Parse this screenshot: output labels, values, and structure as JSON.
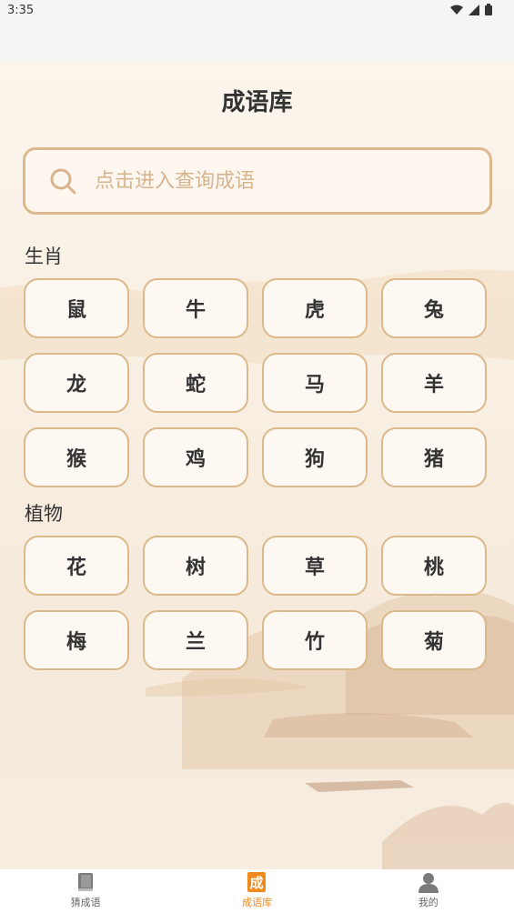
{
  "status_bar": {
    "time": "3:35",
    "icons": [
      "wifi-icon",
      "signal-icon",
      "battery-icon"
    ]
  },
  "page": {
    "title": "成语库"
  },
  "search": {
    "placeholder": "点击进入查询成语",
    "icon": "search-icon"
  },
  "sections": [
    {
      "title": "生肖",
      "items": [
        "鼠",
        "牛",
        "虎",
        "兔",
        "龙",
        "蛇",
        "马",
        "羊",
        "猴",
        "鸡",
        "狗",
        "猪"
      ]
    },
    {
      "title": "植物",
      "items": [
        "花",
        "树",
        "草",
        "桃",
        "梅",
        "兰",
        "竹",
        "菊"
      ]
    }
  ],
  "bottom_nav": [
    {
      "label": "猜成语",
      "icon": "book-icon",
      "active": false
    },
    {
      "label": "成语库",
      "icon": "idiom-library-icon",
      "active": true
    },
    {
      "label": "我的",
      "icon": "user-icon",
      "active": false
    }
  ],
  "colors": {
    "accent": "#f08a1e",
    "chip_border": "#dbb98c",
    "placeholder": "#d8b48e"
  }
}
